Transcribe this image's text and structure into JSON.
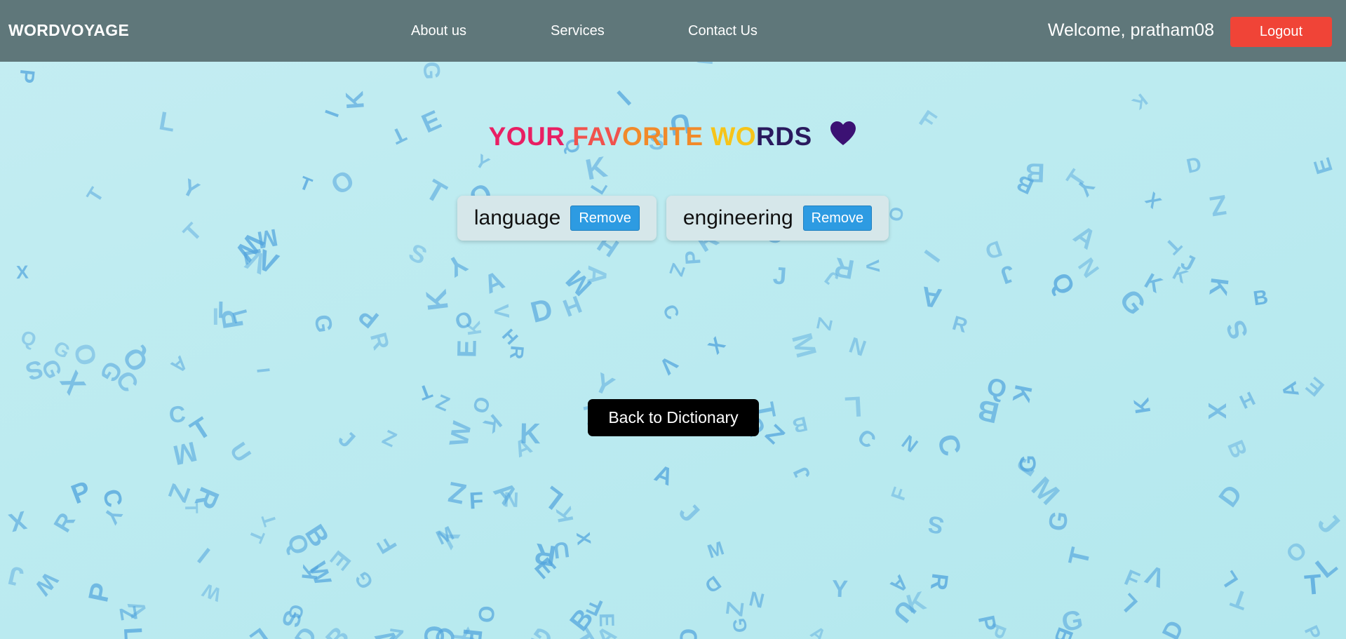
{
  "navbar": {
    "brand": "WORDVOYAGE",
    "links": [
      "About us",
      "Services",
      "Contact Us"
    ],
    "welcome": "Welcome, pratham08",
    "logout_label": "Logout"
  },
  "title": {
    "parts": [
      {
        "text": "YOUR ",
        "color": "#e81f63"
      },
      {
        "text": "FAV",
        "color": "#f0524d"
      },
      {
        "text": "ORITE ",
        "color": "#f18a2a"
      },
      {
        "text": "WO",
        "color": "#f6c419"
      },
      {
        "text": "RDS",
        "color": "#2a1a5e"
      }
    ],
    "heart_icon": "heart-icon",
    "heart_color": "#3b1173"
  },
  "favorites": [
    {
      "word": "language",
      "remove_label": "Remove"
    },
    {
      "word": "engineering",
      "remove_label": "Remove"
    }
  ],
  "back_button": "Back to Dictionary",
  "colors": {
    "navbar": "#5f777a",
    "logout": "#f04437",
    "remove": "#2d9be2",
    "letters": "#4fa3dd"
  },
  "background_letters": [
    "A",
    "B",
    "C",
    "D",
    "E",
    "F",
    "G",
    "H",
    "I",
    "J",
    "K",
    "L",
    "M",
    "N",
    "O",
    "P",
    "Q",
    "R",
    "S",
    "T",
    "U",
    "V",
    "W",
    "X",
    "Y",
    "Z"
  ]
}
